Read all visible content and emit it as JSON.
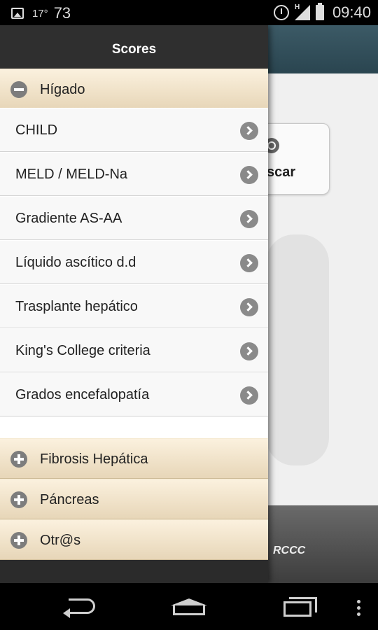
{
  "status_bar": {
    "temperature": "17°",
    "notification_count": "73",
    "network_type": "H",
    "time": "09:40"
  },
  "background_page": {
    "search_button_label": "scar",
    "footer_text": "RCCC"
  },
  "drawer": {
    "title": "Scores",
    "sections": [
      {
        "label": "Hígado",
        "expanded": true,
        "items": [
          "CHILD",
          "MELD / MELD-Na",
          "Gradiente AS-AA",
          "Líquido ascítico d.d",
          "Trasplante hepático",
          "King's College criteria",
          "Grados encefalopatía"
        ]
      },
      {
        "label": "Fibrosis Hepática",
        "expanded": false
      },
      {
        "label": "Páncreas",
        "expanded": false
      },
      {
        "label": "Otr@s",
        "expanded": false
      }
    ]
  },
  "icons": {
    "collapse": "minus-circle-icon",
    "expand": "plus-circle-icon",
    "item_arrow": "chevron-right-circle-icon"
  },
  "colors": {
    "section_header": "#efe2c8",
    "drawer_background": "#2b2b2b",
    "list_item": "#f8f8f8",
    "main_header": "#2f4d58"
  }
}
